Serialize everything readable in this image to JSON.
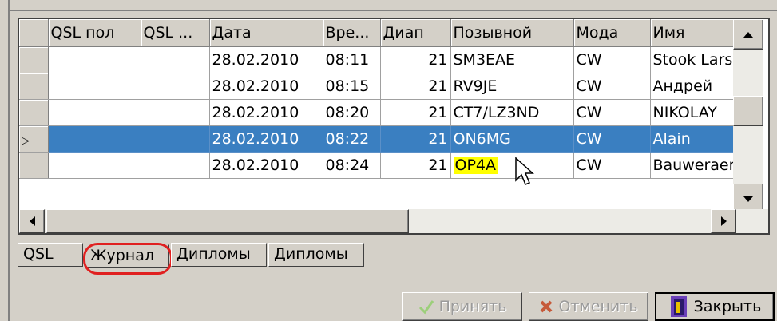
{
  "grid": {
    "columns": [
      "QSL пол",
      "QSL ...",
      "Дата",
      "Вре...",
      "Диап",
      "Позывной",
      "Мода",
      "Имя"
    ],
    "rows": [
      {
        "qsl_rcvd": "",
        "qsl_sent": "",
        "date": "28.02.2010",
        "time": "08:11",
        "band": "21",
        "callsign": "SM3EAE",
        "mode": "CW",
        "name": "Stook Lars"
      },
      {
        "qsl_rcvd": "",
        "qsl_sent": "",
        "date": "28.02.2010",
        "time": "08:15",
        "band": "21",
        "callsign": "RV9JE",
        "mode": "CW",
        "name": "Андрей"
      },
      {
        "qsl_rcvd": "",
        "qsl_sent": "",
        "date": "28.02.2010",
        "time": "08:20",
        "band": "21",
        "callsign": "CT7/LZ3ND",
        "mode": "CW",
        "name": "NIKOLAY"
      },
      {
        "qsl_rcvd": "",
        "qsl_sent": "",
        "date": "28.02.2010",
        "time": "08:22",
        "band": "21",
        "callsign": "ON6MG",
        "mode": "CW",
        "name": "Alain"
      },
      {
        "qsl_rcvd": "",
        "qsl_sent": "",
        "date": "28.02.2010",
        "time": "08:24",
        "band": "21",
        "callsign": "OP4A",
        "mode": "CW",
        "name": "Bauweraer"
      }
    ],
    "selected_row": 3,
    "current_row_marker": "▷"
  },
  "tabs": [
    "QSL",
    "Журнал",
    "Дипломы",
    "Дипломы"
  ],
  "buttons": {
    "accept": "Принять",
    "cancel": "Отменить",
    "close": "Закрыть"
  },
  "colors": {
    "selection": "#3a7fc1",
    "highlight": "#ffff00",
    "annotation_circle": "#e02020",
    "accept_icon": "#5aa02c",
    "cancel_icon": "#d04020"
  }
}
